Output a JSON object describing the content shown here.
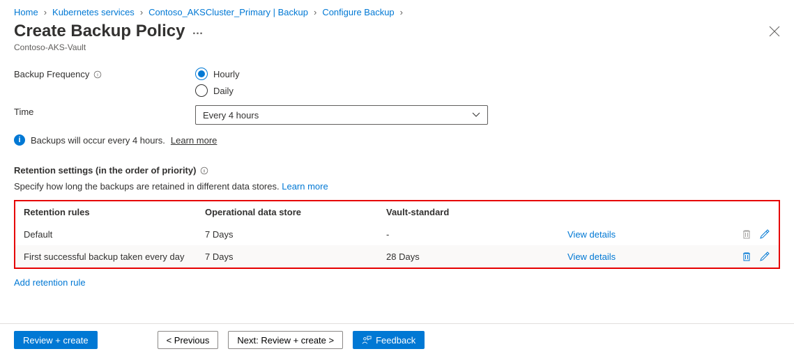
{
  "breadcrumb": {
    "items": [
      "Home",
      "Kubernetes services",
      "Contoso_AKSCluster_Primary | Backup",
      "Configure Backup"
    ]
  },
  "header": {
    "title": "Create Backup Policy",
    "subtitle": "Contoso-AKS-Vault"
  },
  "frequency": {
    "label": "Backup Frequency",
    "options": {
      "hourly": "Hourly",
      "daily": "Daily"
    }
  },
  "time": {
    "label": "Time",
    "selected": "Every 4 hours"
  },
  "info": {
    "text": "Backups will occur every 4 hours.",
    "learn_more": "Learn more"
  },
  "retention": {
    "title": "Retention settings (in the order of priority)",
    "desc": "Specify how long the backups are retained in different data stores.",
    "learn_more": "Learn more",
    "columns": {
      "rules": "Retention rules",
      "ods": "Operational data store",
      "vault": "Vault-standard"
    },
    "rows": [
      {
        "name": "Default",
        "ods": "7 Days",
        "vault": "-",
        "view": "View details"
      },
      {
        "name": "First successful backup taken every day",
        "ods": "7 Days",
        "vault": "28 Days",
        "view": "View details"
      }
    ],
    "add_rule": "Add retention rule"
  },
  "footer": {
    "review_create": "Review + create",
    "previous": "<  Previous",
    "next": "Next: Review + create  >",
    "feedback": "Feedback"
  }
}
